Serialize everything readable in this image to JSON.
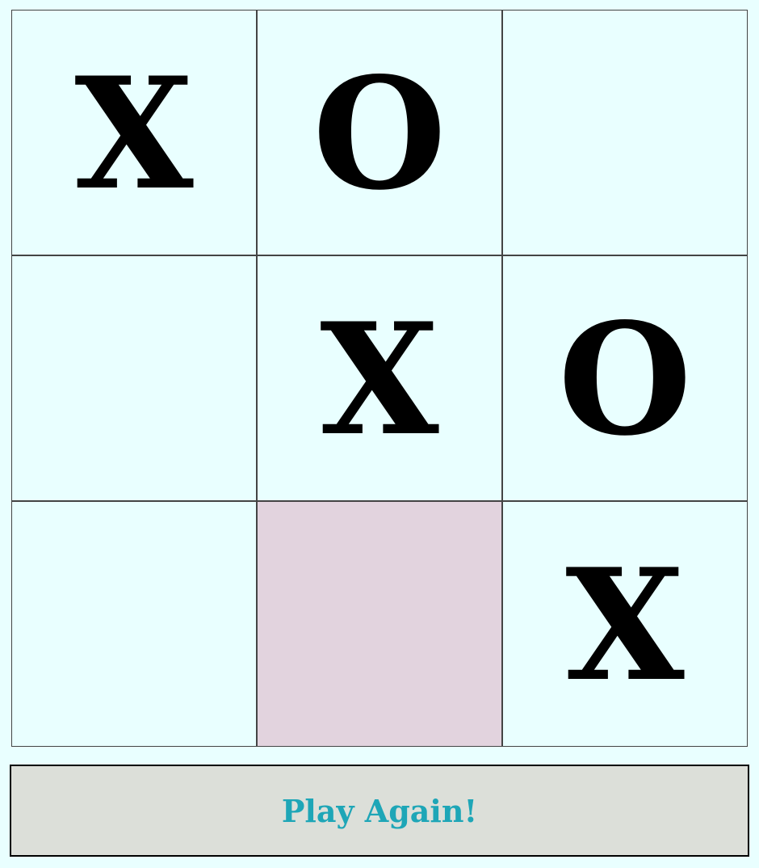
{
  "board": {
    "cells": [
      "X",
      "O",
      "",
      "",
      "X",
      "O",
      "",
      "",
      "X"
    ],
    "hover_cell_index": 7
  },
  "controls": {
    "play_again_label": "Play Again!"
  },
  "colors": {
    "background": "#e9ffff",
    "grid_line": "#444444",
    "hover_cell": "#e2d3de",
    "button_bg": "#dcdfd9",
    "button_text": "#1ea6b7",
    "mark": "#000000"
  }
}
